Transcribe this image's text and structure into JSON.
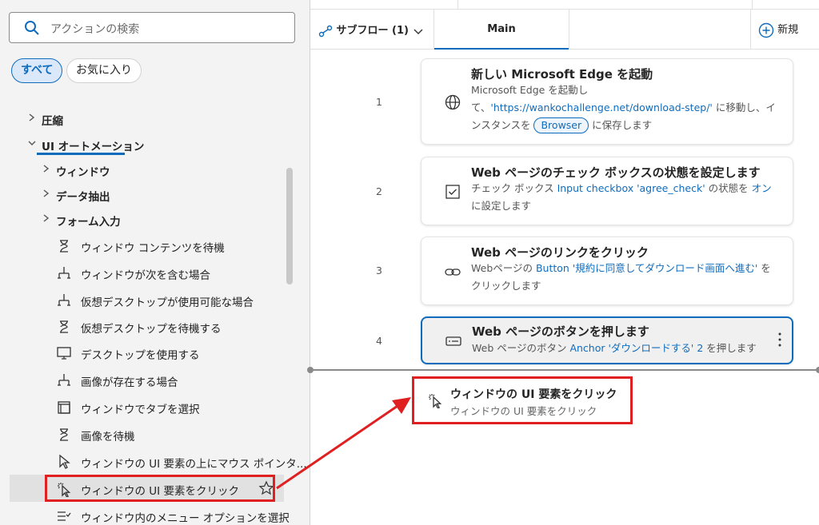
{
  "search": {
    "placeholder": "アクションの検索"
  },
  "filters": {
    "all": "すべて",
    "favorites": "お気に入り"
  },
  "tree": {
    "compress": "圧縮",
    "ui_automation": "UI オートメーション",
    "window": "ウィンドウ",
    "data_extract": "データ抽出",
    "form_input": "フォーム入力"
  },
  "actions": [
    {
      "label": "ウィンドウ コンテンツを待機",
      "icon": "hourglass-icon"
    },
    {
      "label": "ウィンドウが次を含む場合",
      "icon": "branch-icon"
    },
    {
      "label": "仮想デスクトップが使用可能な場合",
      "icon": "branch-icon"
    },
    {
      "label": "仮想デスクトップを待機する",
      "icon": "hourglass-icon"
    },
    {
      "label": "デスクトップを使用する",
      "icon": "monitor-icon"
    },
    {
      "label": "画像が存在する場合",
      "icon": "branch-icon"
    },
    {
      "label": "ウィンドウでタブを選択",
      "icon": "tab-window-icon"
    },
    {
      "label": "画像を待機",
      "icon": "hourglass-icon"
    },
    {
      "label": "ウィンドウの UI 要素の上にマウス ポインタ...",
      "icon": "cursor-icon"
    },
    {
      "label": "ウィンドウの UI 要素をクリック",
      "icon": "click-cursor-icon"
    },
    {
      "label": "ウィンドウ内のメニュー オプションを選択",
      "icon": "menu-check-icon"
    }
  ],
  "tabs": {
    "subflow": "サブフロー (1)",
    "main": "Main",
    "new": "新規"
  },
  "steps": [
    {
      "num": "1",
      "icon": "globe-icon",
      "title": "新しい Microsoft Edge を起動",
      "desc_a": "Microsoft Edge を起動して、",
      "desc_link": "'https://wankochallenge.net/download-step/'",
      "desc_b": " に移動し、インスタンスを ",
      "desc_var": "Browser",
      "desc_c": " に保存します"
    },
    {
      "num": "2",
      "icon": "checkbox-icon",
      "title": "Web ページのチェック ボックスの状態を設定します",
      "desc_a": "チェック ボックス ",
      "desc_link": "Input checkbox 'agree_check'",
      "desc_b": " の状態を ",
      "desc_link2": "オン",
      "desc_c": " に設定します"
    },
    {
      "num": "3",
      "icon": "link-icon",
      "title": "Web ページのリンクをクリック",
      "desc_a": "Webページの ",
      "desc_link": "Button '規約に同意してダウンロード画面へ進む'",
      "desc_b": " をクリックします"
    },
    {
      "num": "4",
      "icon": "button-icon",
      "title": "Web ページのボタンを押します",
      "desc_a": "Web ページのボタン ",
      "desc_link": "Anchor 'ダウンロードする' 2",
      "desc_b": " を押します"
    }
  ],
  "drag_preview": {
    "title": "ウィンドウの UI 要素をクリック",
    "desc": "ウィンドウの UI 要素をクリック"
  },
  "colors": {
    "accent": "#0f6cbd",
    "annotation_red": "#e02020"
  }
}
